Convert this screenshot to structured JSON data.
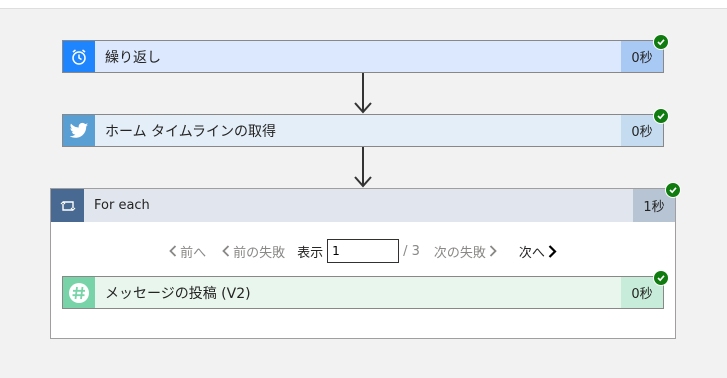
{
  "steps": {
    "recurrence": {
      "title": "繰り返し",
      "duration": "0秒"
    },
    "twitter": {
      "title": "ホーム タイムラインの取得",
      "duration": "0秒"
    },
    "slack": {
      "title": "メッセージの投稿 (V2)",
      "duration": "0秒"
    }
  },
  "foreach": {
    "title": "For each",
    "duration": "1秒",
    "pager": {
      "prev": "前へ",
      "prev_failed": "前の失敗",
      "show": "表示",
      "current": "1",
      "total": "/ 3",
      "next_failed": "次の失敗",
      "next": "次へ"
    }
  },
  "colors": {
    "success": "#107c10",
    "recurrence_icon_bg": "#1f85ff",
    "twitter_icon_bg": "#5a9fd4",
    "slack_icon_bg": "#78d3a8",
    "foreach_icon_bg": "#486991"
  },
  "icons": [
    "alarm-clock-icon",
    "twitter-bird-icon",
    "loop-icon",
    "slack-hash-icon",
    "check-icon",
    "chevron-left-icon",
    "chevron-right-icon"
  ]
}
